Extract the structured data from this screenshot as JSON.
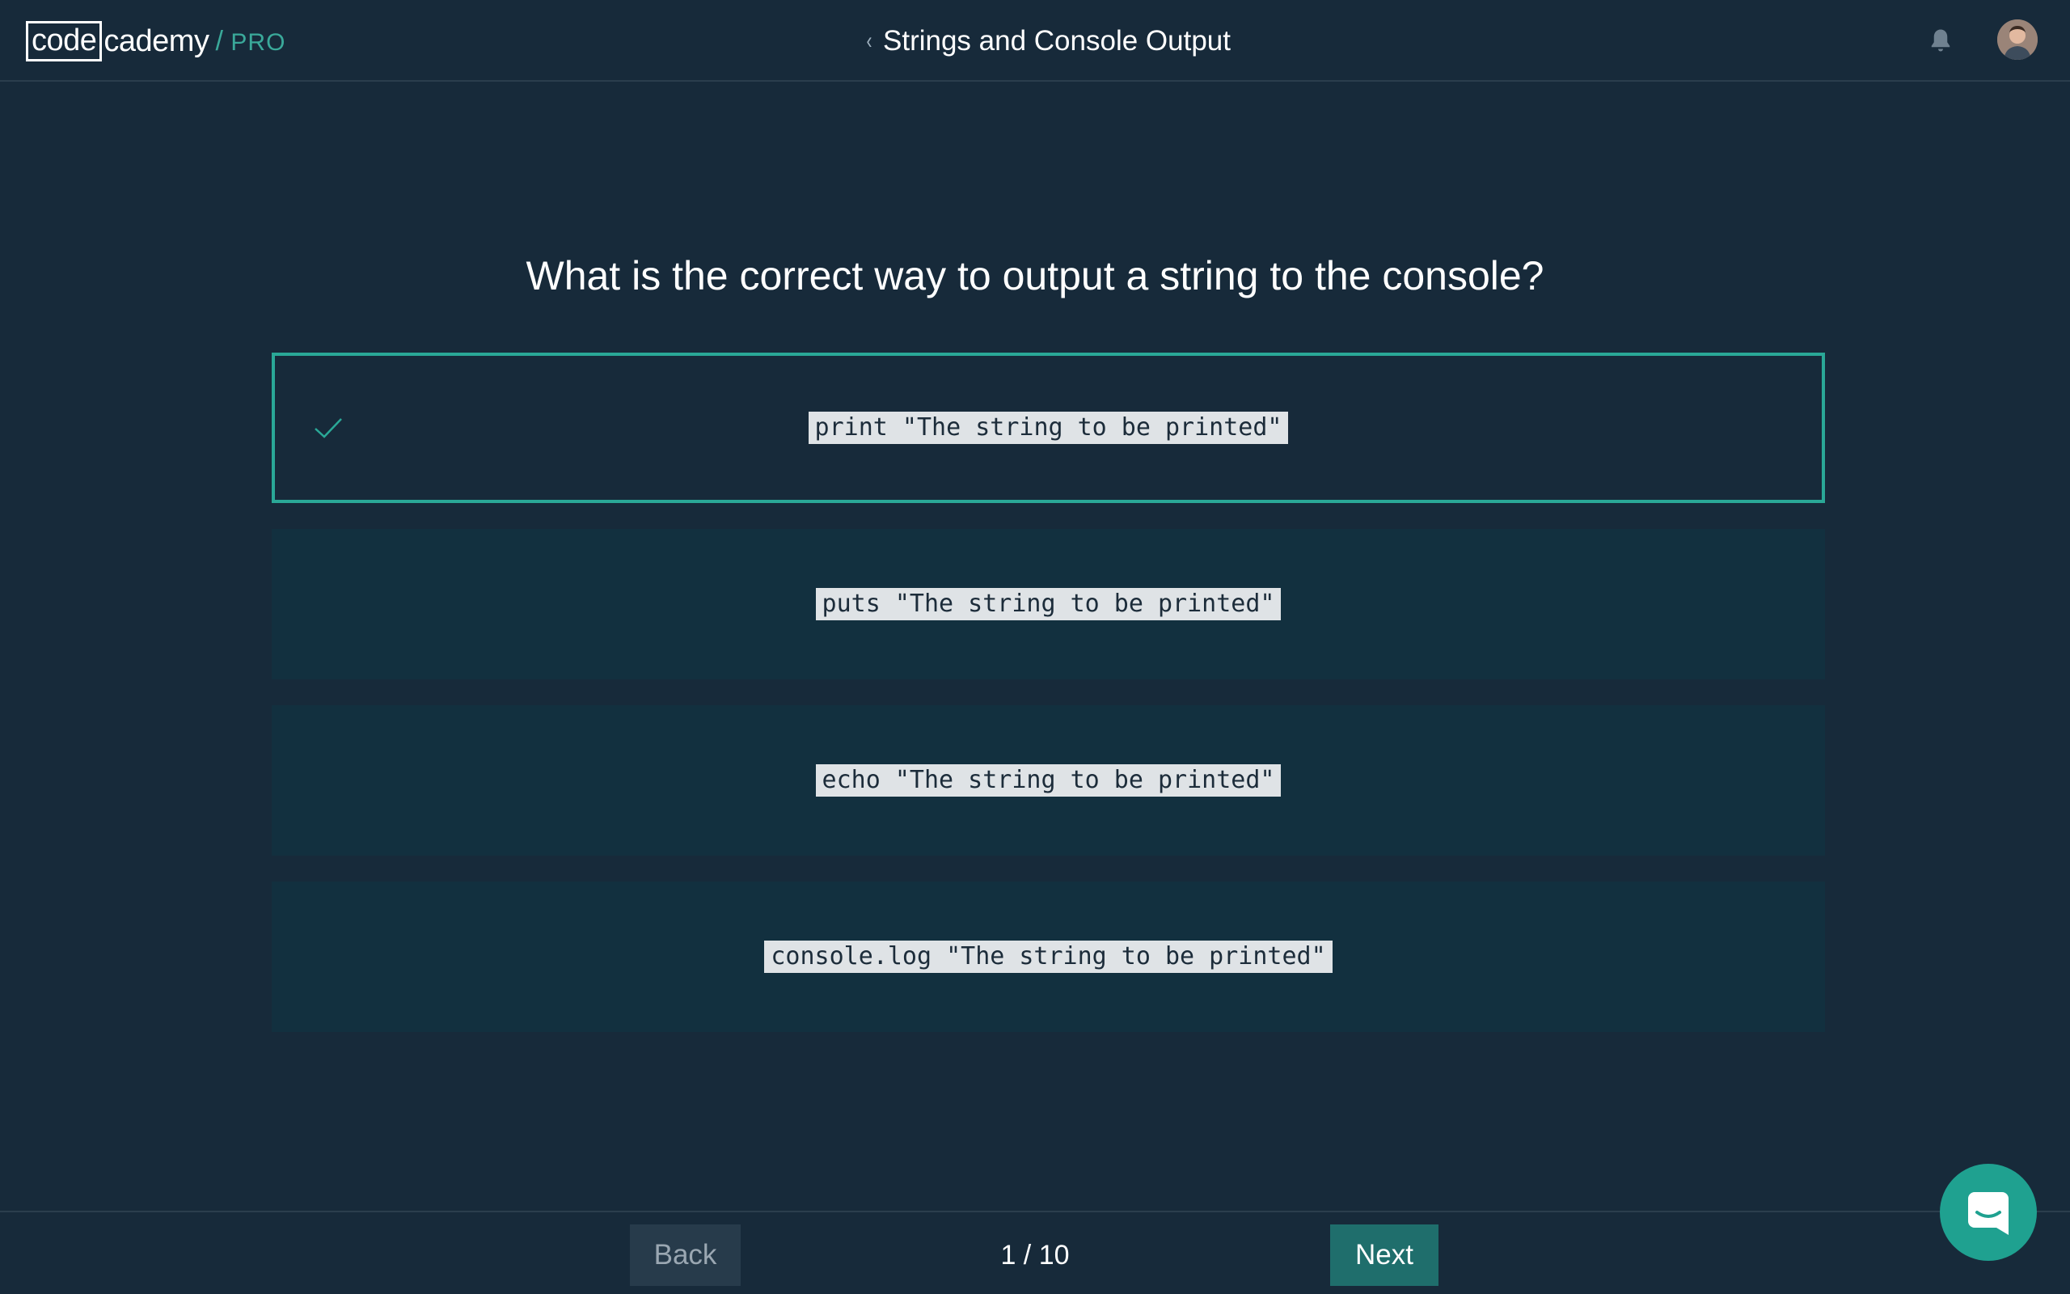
{
  "header": {
    "logo": {
      "code": "code",
      "cademy": "cademy",
      "slash": "/",
      "pro": "PRO"
    },
    "back_chevron_icon": "chevron-left-icon",
    "course_title": "Strings and Console Output",
    "notification_icon": "bell-icon",
    "avatar_icon": "user-avatar"
  },
  "quiz": {
    "question": "What is the correct way to output a string to the console?",
    "options": [
      {
        "code": "print \"The string to be printed\"",
        "selected": true
      },
      {
        "code": "puts \"The string to be printed\"",
        "selected": false
      },
      {
        "code": "echo \"The string to be printed\"",
        "selected": false
      },
      {
        "code": "console.log \"The string to be printed\"",
        "selected": false
      }
    ],
    "selected_icon": "checkmark-icon"
  },
  "footer": {
    "back_label": "Back",
    "progress": "1 / 10",
    "next_label": "Next"
  },
  "chat": {
    "icon": "chat-bubble-icon"
  },
  "colors": {
    "background": "#172a3a",
    "option_background": "#12303f",
    "accent": "#2aa897",
    "next_button": "#1f6e6c",
    "back_button": "#273b4b"
  }
}
